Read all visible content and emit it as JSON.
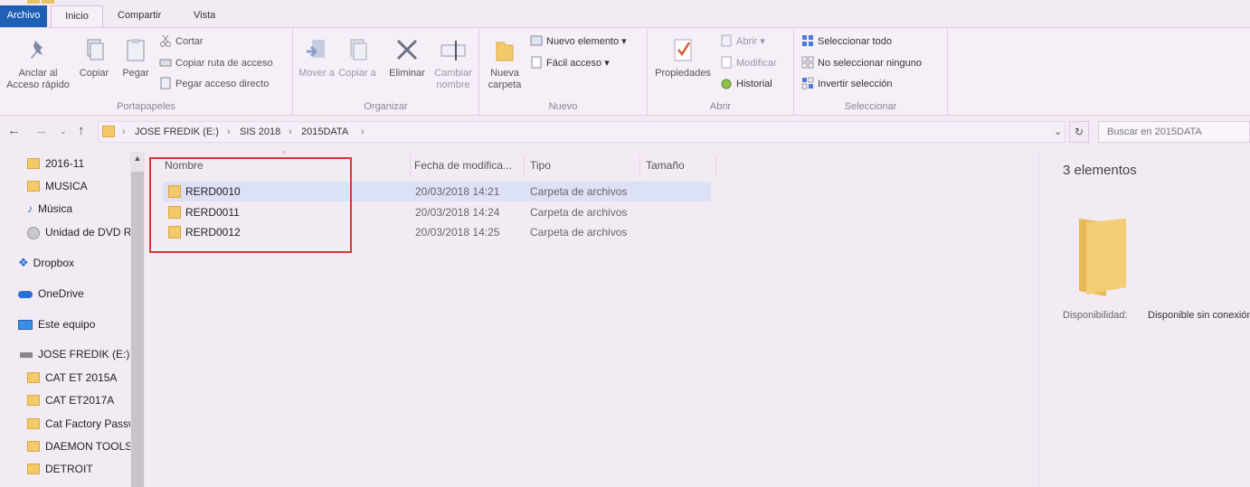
{
  "tabs": {
    "file": "Archivo",
    "home": "Inicio",
    "share": "Compartir",
    "view": "Vista"
  },
  "ribbon": {
    "clipboard": {
      "label": "Portapapeles",
      "pin": "Anclar al Acceso rápido",
      "copy": "Copiar",
      "paste": "Pegar",
      "cut": "Cortar",
      "copy_path": "Copiar ruta de acceso",
      "paste_shortcut": "Pegar acceso directo"
    },
    "organize": {
      "label": "Organizar",
      "move": "Mover a",
      "copy_to": "Copiar a",
      "delete": "Eliminar",
      "rename": "Cambiar nombre"
    },
    "new": {
      "label": "Nuevo",
      "new_folder": "Nueva carpeta",
      "new_item": "Nuevo elemento",
      "easy_access": "Fácil acceso"
    },
    "open": {
      "label": "Abrir",
      "properties": "Propiedades",
      "open": "Abrir",
      "edit": "Modificar",
      "history": "Historial"
    },
    "select": {
      "label": "Seleccionar",
      "all": "Seleccionar todo",
      "none": "No seleccionar ninguno",
      "invert": "Invertir selección"
    }
  },
  "address": {
    "crumbs": [
      "JOSE FREDIK (E:)",
      "SIS 2018",
      "2015DATA"
    ],
    "search_placeholder": "Buscar en 2015DATA"
  },
  "sidebar": {
    "items": [
      "2016-11",
      "MUSICA",
      "Música",
      "Unidad de DVD RW",
      "Dropbox",
      "OneDrive",
      "Este equipo",
      "JOSE FREDIK (E:)",
      "CAT ET 2015A",
      "CAT ET2017A",
      "Cat Factory Password",
      "DAEMON TOOLS",
      "DETROIT"
    ]
  },
  "columns": {
    "name": "Nombre",
    "date": "Fecha de modifica...",
    "type": "Tipo",
    "size": "Tamaño"
  },
  "files": [
    {
      "name": "RERD0010",
      "date": "20/03/2018 14:21",
      "type": "Carpeta de archivos"
    },
    {
      "name": "RERD0011",
      "date": "20/03/2018 14:24",
      "type": "Carpeta de archivos"
    },
    {
      "name": "RERD0012",
      "date": "20/03/2018 14:25",
      "type": "Carpeta de archivos"
    }
  ],
  "preview": {
    "count": "3 elementos",
    "availability_label": "Disponibilidad:",
    "availability_value": "Disponible sin conexión"
  },
  "colors": {
    "accent": "#1f5fb5",
    "folder": "#f4c96a",
    "highlight": "#d93636",
    "selection": "#dde1f6"
  }
}
